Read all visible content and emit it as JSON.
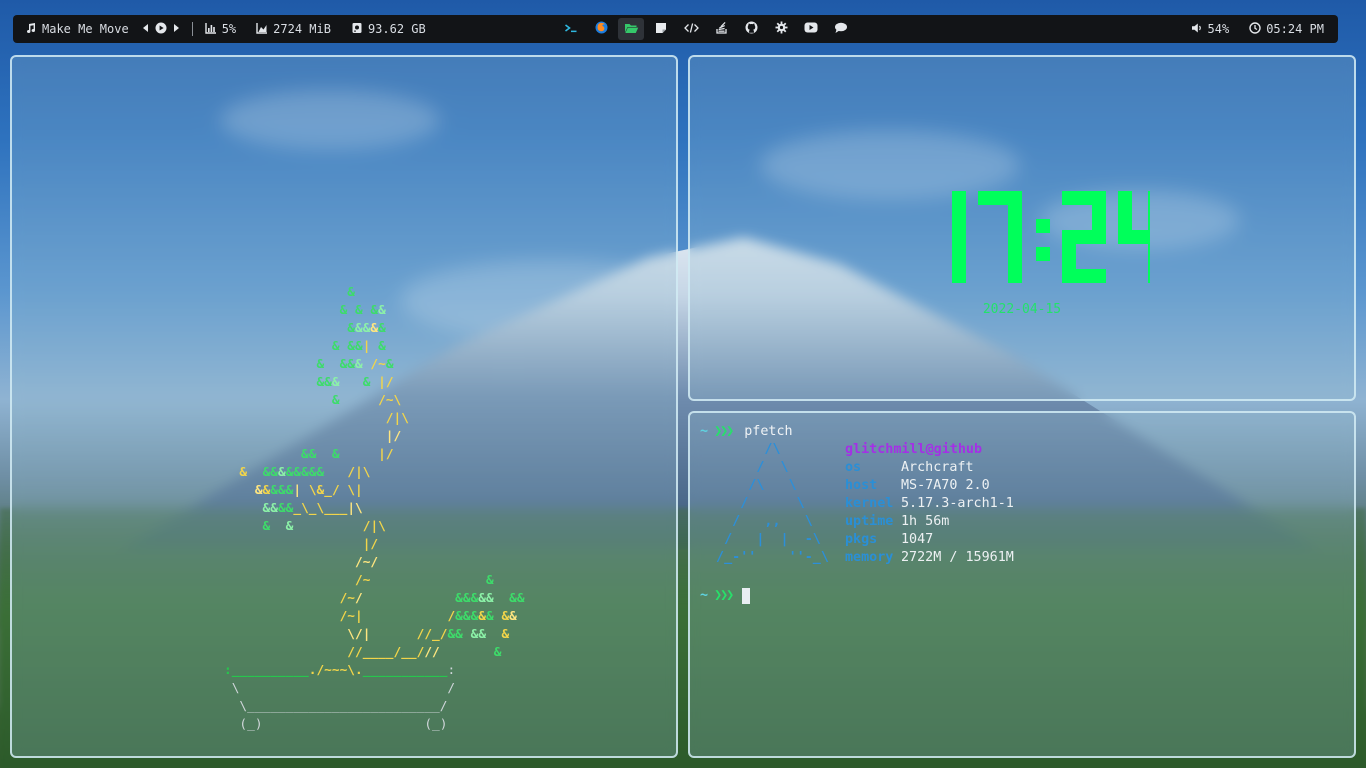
{
  "topbar": {
    "music": {
      "icon": "music-note-icon",
      "title": "Make Me Move"
    },
    "cpu": {
      "icon": "bar-chart-icon",
      "value": "5%"
    },
    "memory": {
      "icon": "area-chart-icon",
      "value": "2724 MiB"
    },
    "disk": {
      "icon": "hard-disk-icon",
      "value": "93.62 GB"
    },
    "apps": [
      {
        "name": "terminal-icon",
        "active": false
      },
      {
        "name": "firefox-icon",
        "active": false
      },
      {
        "name": "folder-icon",
        "active": true
      },
      {
        "name": "sticky-note-icon",
        "active": false
      },
      {
        "name": "code-icon",
        "active": false
      },
      {
        "name": "stack-icon",
        "active": false
      },
      {
        "name": "github-icon",
        "active": false
      },
      {
        "name": "settings-icon",
        "active": false
      },
      {
        "name": "youtube-icon",
        "active": false
      },
      {
        "name": "chat-icon",
        "active": false
      }
    ],
    "volume": {
      "icon": "volume-icon",
      "value": "54%"
    },
    "time": {
      "icon": "clock-icon",
      "value": "05:24 PM"
    }
  },
  "clock": {
    "time": "17:24",
    "date": "2022-04-15",
    "color": "#00ff5a"
  },
  "terminal": {
    "prompt_symbol": "~",
    "prompt_arrows": "❯❯❯",
    "command": "pfetch",
    "userhost": "glitchmill@github",
    "info": [
      {
        "key": "os",
        "value": "Archcraft"
      },
      {
        "key": "host",
        "value": "MS-7A70 2.0"
      },
      {
        "key": "kernel",
        "value": "5.17.3-arch1-1"
      },
      {
        "key": "uptime",
        "value": "1h 56m"
      },
      {
        "key": "pkgs",
        "value": "1047"
      },
      {
        "key": "memory",
        "value": "2722M / 15961M"
      }
    ]
  },
  "colors": {
    "accent_green": "#27e06a",
    "key_blue": "#2a8fd6",
    "user_purple": "#a430e6",
    "topbar_bg": "#121417"
  }
}
